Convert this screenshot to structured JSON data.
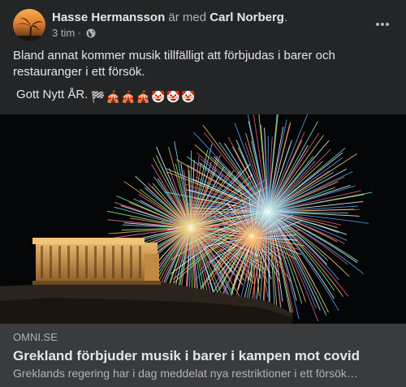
{
  "post": {
    "author": "Hasse Hermansson",
    "with_text": "är med",
    "tagged": "Carl Norberg",
    "tagged_suffix": ".",
    "time": "3 tim",
    "dot": "·",
    "audience_icon": "globe-icon",
    "message_line1": "Bland annat kommer musik tillfälligt att förbjudas i barer och restauranger i ett försök.",
    "message_line2": "Gott Nytt ÅR.",
    "emojis": [
      "🏁",
      "🎪",
      "🎪",
      "🎪",
      "🤡",
      "🤡",
      "🤡"
    ]
  },
  "link": {
    "domain": "OMNI.SE",
    "title": "Grekland förbjuder musik i barer i kampen mot covid",
    "description": "Greklands regering har i dag meddelat nya restriktioner i ett försök…"
  },
  "colors": {
    "background": "#242526",
    "card": "#3a3b3c",
    "primary_text": "#e4e6eb",
    "secondary_text": "#b0b3b8"
  }
}
